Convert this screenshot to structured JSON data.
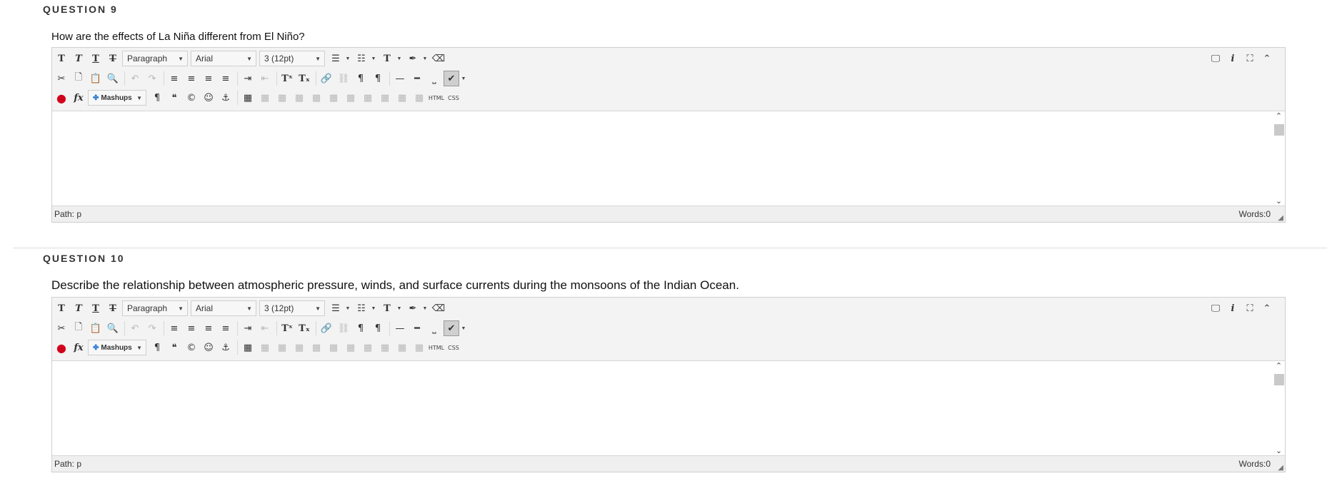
{
  "questions": [
    {
      "heading": "QUESTION 9",
      "prompt": "How are the effects of La Niña different from El Niño?",
      "editor": {
        "format": "Paragraph",
        "font": "Arial",
        "size": "3 (12pt)",
        "mashups": "Mashups",
        "html_label": "HTML",
        "css_label": "CSS",
        "path_label": "Path:",
        "path_value": "p",
        "words_label": "Words:",
        "words_value": "0"
      }
    },
    {
      "heading": "QUESTION 10",
      "prompt": "Describe the relationship between atmospheric pressure, winds, and surface currents during the monsoons of the Indian Ocean.",
      "editor": {
        "format": "Paragraph",
        "font": "Arial",
        "size": "3 (12pt)",
        "mashups": "Mashups",
        "html_label": "HTML",
        "css_label": "CSS",
        "path_label": "Path:",
        "path_value": "p",
        "words_label": "Words:",
        "words_value": "0"
      }
    }
  ],
  "icons": {
    "bold": "T",
    "italic": "T",
    "underline": "T",
    "strike": "T",
    "bullet_list": "☰",
    "numbered_list": "☷",
    "text_color": "T",
    "highlight": "✒",
    "eraser": "⌫",
    "cut": "✂",
    "copy": "🗋",
    "paste": "📋",
    "find": "🔍",
    "undo": "↶",
    "redo": "↷",
    "align_left": "≡",
    "align_center": "≡",
    "align_right": "≡",
    "justify": "≡",
    "indent": "⇥",
    "outdent": "⇤",
    "superscript": "Tˣ",
    "subscript": "Tₓ",
    "link": "🔗",
    "unlink": "⛓",
    "ltr": "¶",
    "rtl": "¶",
    "hr": "—",
    "hr_thick": "━",
    "nbsp": "⎵",
    "spellcheck": "✔",
    "record": "●",
    "math": "fx",
    "paragraph_mark": "¶",
    "quote": "❝",
    "copyright": "©",
    "emoticon": "☺",
    "anchor": "⚓",
    "table": "▦",
    "preview": "🖵",
    "info": "i",
    "fullscreen": "⛶",
    "collapse": "⌃"
  },
  "accent_red": "#d0021b",
  "accent_blue": "#2a7bd4"
}
